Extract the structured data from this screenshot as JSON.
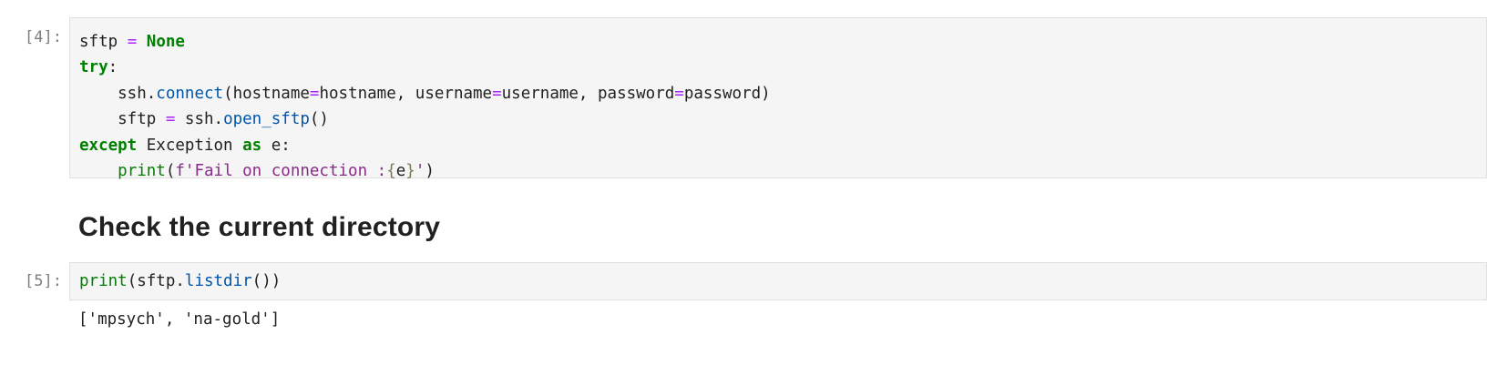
{
  "cell4": {
    "prompt": "[4]:",
    "lines": [
      [
        {
          "t": "sftp ",
          "c": "var"
        },
        {
          "t": "=",
          "c": "op"
        },
        {
          "t": " ",
          "c": "var"
        },
        {
          "t": "None",
          "c": "kw"
        }
      ],
      [
        {
          "t": "try",
          "c": "kw"
        },
        {
          "t": ":",
          "c": "var"
        }
      ],
      [
        {
          "t": "    ssh.",
          "c": "var"
        },
        {
          "t": "connect",
          "c": "fn"
        },
        {
          "t": "(hostname",
          "c": "var"
        },
        {
          "t": "=",
          "c": "op"
        },
        {
          "t": "hostname, username",
          "c": "var"
        },
        {
          "t": "=",
          "c": "op"
        },
        {
          "t": "username, password",
          "c": "var"
        },
        {
          "t": "=",
          "c": "op"
        },
        {
          "t": "password)",
          "c": "var"
        }
      ],
      [
        {
          "t": "    sftp ",
          "c": "var"
        },
        {
          "t": "=",
          "c": "op"
        },
        {
          "t": " ssh.",
          "c": "var"
        },
        {
          "t": "open_sftp",
          "c": "fn"
        },
        {
          "t": "()",
          "c": "var"
        }
      ],
      [
        {
          "t": "except",
          "c": "kw"
        },
        {
          "t": " Exception ",
          "c": "var"
        },
        {
          "t": "as",
          "c": "kw"
        },
        {
          "t": " e:",
          "c": "var"
        }
      ],
      [
        {
          "t": "    ",
          "c": "var"
        },
        {
          "t": "print",
          "c": "bi"
        },
        {
          "t": "(",
          "c": "var"
        },
        {
          "t": "f'Fail on connection :",
          "c": "strp"
        },
        {
          "t": "{",
          "c": "brace"
        },
        {
          "t": "e",
          "c": "var"
        },
        {
          "t": "}",
          "c": "brace"
        },
        {
          "t": "'",
          "c": "strp"
        },
        {
          "t": ")",
          "c": "var"
        }
      ]
    ]
  },
  "markdown": {
    "heading": "Check the current directory"
  },
  "cell5": {
    "prompt": "[5]:",
    "lines": [
      [
        {
          "t": "print",
          "c": "bi"
        },
        {
          "t": "(sftp.",
          "c": "var"
        },
        {
          "t": "listdir",
          "c": "fn"
        },
        {
          "t": "())",
          "c": "var"
        }
      ]
    ],
    "output": "['mpsych', 'na-gold']"
  },
  "colors": {
    "keyword": "#008000",
    "operator": "#aa22ff",
    "function": "#0055aa",
    "string": "#8a2b8a",
    "prompt": "#7f7f7f",
    "editor_bg": "#f5f5f5"
  }
}
